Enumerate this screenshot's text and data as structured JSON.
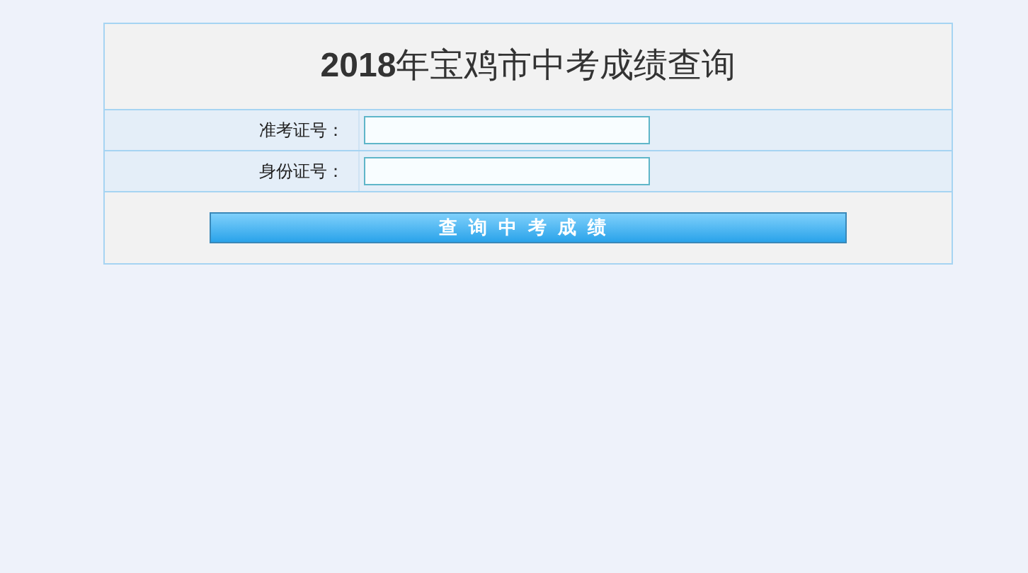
{
  "title": "**2018**年宝鸡市中考成绩查询",
  "fields": [
    {
      "label": "准考证号："
    },
    {
      "label": "身份证号："
    }
  ],
  "submit_button": "查询中考成绩"
}
